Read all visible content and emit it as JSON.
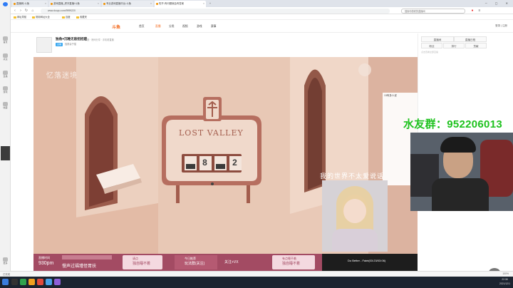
{
  "rail": {
    "items": [
      "首页",
      "关注",
      "直播",
      "游戏",
      "收藏",
      "更多"
    ]
  },
  "tabs": [
    {
      "label": "直播网-斗鱼",
      "active": false
    },
    {
      "label": "游戏直播_虎牙直播/斗鱼",
      "active": false
    },
    {
      "label": "专业游戏直播平台-斗鱼",
      "active": false
    },
    {
      "label": "知乎-有问题就会有答案",
      "active": true
    }
  ],
  "window_controls": "─ ▢ ✕",
  "address": {
    "url": "www.douyu.com/9999220",
    "search_placeholder": "搜索你想看的直播间"
  },
  "bookmarks": [
    "网址导航",
    "常用网址大全",
    "百度",
    "收藏夹"
  ],
  "site": {
    "logo": "斗鱼",
    "nav": [
      {
        "label": "首页",
        "on": false
      },
      {
        "label": "直播",
        "on": true
      },
      {
        "label": "分类",
        "on": false
      },
      {
        "label": "视频",
        "on": false
      },
      {
        "label": "游戏",
        "on": false
      },
      {
        "label": "赛事",
        "on": false
      }
    ],
    "right": "登录 | 注册"
  },
  "room": {
    "title": "独角♥沉睡无敌招招建",
    "meta": "举报 · 房间分享 · 手机看直播",
    "tag": "主播",
    "category": "独角兽子猫"
  },
  "scene": {
    "title_left": "忆落迷境",
    "sign": "LOST VALLEY",
    "dials": [
      "",
      "8",
      "",
      "2"
    ],
    "lyric_overlay": "我的世界不太爱说话",
    "banner_lyrics": "Do Better - Faint(03:23/03:06)"
  },
  "overlay_bar": {
    "live_label": "直播时间",
    "live_value": "930pm",
    "item1": "慢声过福瑾怪胃扶",
    "item2_title": "请点",
    "item2": "独自睡不着",
    "item3_title": "今日推荐",
    "item3": "玩法群(关注)",
    "item4": "关注+VX",
    "item5_title": "有点睡不着",
    "item5": "独自睡不着"
  },
  "side": {
    "tabs": [
      "直播间",
      "直播日程",
      "粉丝",
      "排行",
      "贡献"
    ],
    "note": "点击查看全部直播",
    "chat_prefix": "13有多人说"
  },
  "qq_banner": "水友群：952206013",
  "taskbar": {
    "time": "22:38",
    "date": "2021/12/1"
  },
  "statusbar": {
    "left": "已完成",
    "right": "100%"
  },
  "colors": {
    "accent": "#f36c21",
    "qq_green": "#1ec21e",
    "scene_bg": "#e7c6b3",
    "overlay_pink": "#a34b63"
  }
}
